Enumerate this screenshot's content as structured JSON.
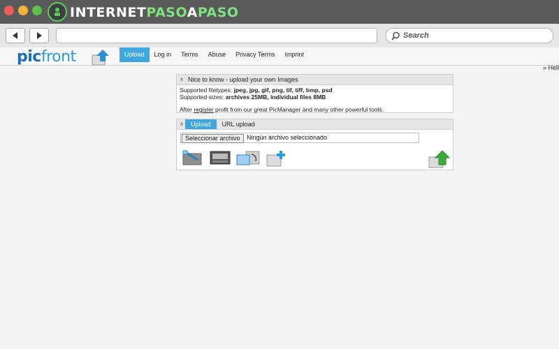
{
  "browser": {
    "brand": {
      "part1": "INTERNET",
      "part2": "PASO",
      "part3": "A",
      "part4": "PASO"
    },
    "url": "",
    "search_placeholder": "Search"
  },
  "site": {
    "logo_pic": "pic",
    "logo_front": "front",
    "menu": [
      "Upload",
      "Log in",
      "Terms",
      "Abuse",
      "Privacy Terms",
      "Imprint"
    ],
    "active_menu": "Upload",
    "hello": "» Hell"
  },
  "info_panel": {
    "title": "Nice to know - upload your own Images",
    "types_label": "Supported filetypes: ",
    "types_value": "jpeg, jpg, gif, png, tif, tiff, bmp, psd",
    "sizes_label": "Supported sizes: ",
    "sizes_value": "archives 25MB, individual files 8MB",
    "after_pre": "After ",
    "after_link": "register",
    "after_post": " profit from our great PicManager and many other powerful tools."
  },
  "upload_panel": {
    "tabs": [
      "Upload",
      "URL upload"
    ],
    "active_tab": "Upload",
    "file_button": "Seleccionar archivo",
    "file_status": "Ningún archivo seleccionado"
  },
  "colors": {
    "accent": "#3fa7df",
    "logo_dark": "#1d6fb8",
    "upload_green": "#3daa3d"
  },
  "icons": [
    "edit-image-icon",
    "frame-icon",
    "resize-icon",
    "add-image-icon",
    "upload-arrow-icon"
  ]
}
